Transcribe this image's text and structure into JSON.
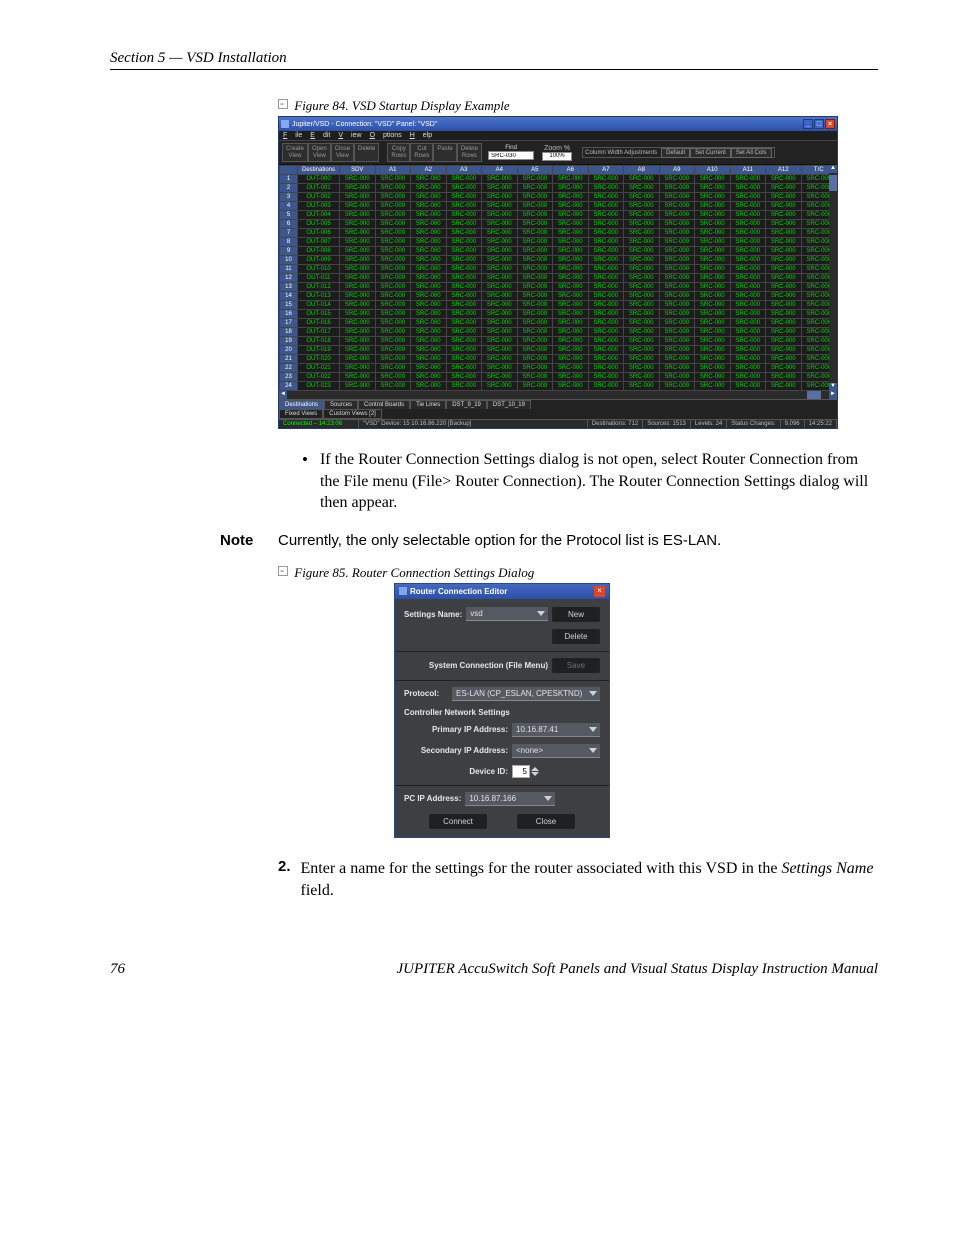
{
  "header": {
    "section_label": "Section 5 — VSD Installation"
  },
  "figure84": {
    "caption": "Figure 84.  VSD Startup Display Example",
    "window_title": "Jupiter/VSD - Connection: \"VSD\"  Panel: \"VSD\"",
    "menus": [
      "File",
      "Edit",
      "View",
      "Options",
      "Help"
    ],
    "toolbar": {
      "left_buttons": [
        [
          "Create",
          "View"
        ],
        [
          "Open",
          "View"
        ],
        [
          "Close",
          "View"
        ],
        [
          "Delete",
          ""
        ]
      ],
      "mid_buttons": [
        [
          "Copy",
          "Rows"
        ],
        [
          "Cut",
          "Rows"
        ],
        [
          "Paste",
          ""
        ],
        [
          "Delete",
          "Rows"
        ]
      ],
      "find_label": "Find",
      "find_value": "SRC-030",
      "zoom_label": "Zoom %",
      "zoom_value": "100%",
      "cwa_label": "Column Width Adjustments",
      "cwa_buttons": [
        "Default",
        "Set Current",
        "Set All Cols"
      ]
    },
    "columns": [
      "",
      "Destinations",
      "SDV",
      "A1",
      "A2",
      "A3",
      "A4",
      "A5",
      "A6",
      "A7",
      "A8",
      "A9",
      "A10",
      "A11",
      "A12",
      "T/C"
    ],
    "rows": [
      {
        "n": "1",
        "dest": "OUT-000"
      },
      {
        "n": "2",
        "dest": "OUT-001"
      },
      {
        "n": "3",
        "dest": "OUT-002"
      },
      {
        "n": "4",
        "dest": "OUT-003"
      },
      {
        "n": "5",
        "dest": "OUT-004"
      },
      {
        "n": "6",
        "dest": "OUT-005"
      },
      {
        "n": "7",
        "dest": "OUT-006"
      },
      {
        "n": "8",
        "dest": "OUT-007"
      },
      {
        "n": "9",
        "dest": "OUT-008"
      },
      {
        "n": "10",
        "dest": "OUT-009"
      },
      {
        "n": "11",
        "dest": "OUT-010"
      },
      {
        "n": "12",
        "dest": "OUT-011"
      },
      {
        "n": "13",
        "dest": "OUT-012"
      },
      {
        "n": "14",
        "dest": "OUT-013"
      },
      {
        "n": "15",
        "dest": "OUT-014"
      },
      {
        "n": "16",
        "dest": "OUT-015"
      },
      {
        "n": "17",
        "dest": "OUT-016"
      },
      {
        "n": "18",
        "dest": "OUT-017"
      },
      {
        "n": "19",
        "dest": "OUT-018"
      },
      {
        "n": "20",
        "dest": "OUT-019"
      },
      {
        "n": "21",
        "dest": "OUT-020"
      },
      {
        "n": "22",
        "dest": "OUT-021"
      },
      {
        "n": "23",
        "dest": "OUT-022"
      },
      {
        "n": "24",
        "dest": "OUT-023"
      }
    ],
    "cell_value": "SRC-000",
    "tabs_row1": [
      "Destinations",
      "Sources",
      "Control Boards",
      "Tie Lines",
      "DST_9_19",
      "DST_10_19"
    ],
    "tabs_row1_active": "Destinations",
    "tabs_row2": [
      "Fixed Views",
      "Custom Views [2]"
    ],
    "status": {
      "connected": "Connected – 14:23:06",
      "device": "\"VSD\" Device: 15   10.16.86.220 [Backup]",
      "destinations": "Destinations:  712",
      "sources": "Sources:  1513",
      "levels": "Levels:  24",
      "status_changes_lbl": "Status Changes:",
      "status_changes_val": "9,096",
      "clock": "14:25:22"
    }
  },
  "body": {
    "bullet1": "If the Router Connection Settings dialog is not open, select Router Connection from the File menu (File> Router Connection). The Router Connection Settings dialog will then appear.",
    "note_label": "Note",
    "note_text": "Currently, the only selectable option for the Protocol list is ES-LAN."
  },
  "figure85": {
    "caption": "Figure 85.  Router Connection Settings Dialog",
    "title": "Router Connection Editor",
    "settings_name_label": "Settings Name:",
    "settings_name_value": "vsd",
    "new_btn": "New",
    "delete_btn": "Delete",
    "system_conn_label": "System Connection (File Menu)",
    "save_btn": "Save",
    "protocol_label": "Protocol:",
    "protocol_value": "ES-LAN (CP_ESLAN, CPESKTND)",
    "cns_label": "Controller Network Settings",
    "primary_ip_label": "Primary IP Address:",
    "primary_ip_value": "10.16.87.41",
    "secondary_ip_label": "Secondary IP Address:",
    "secondary_ip_value": "<none>",
    "device_id_label": "Device ID:",
    "device_id_value": "5",
    "pc_ip_label": "PC IP Address:",
    "pc_ip_value": "10.16.87.166",
    "connect_btn": "Connect",
    "close_btn": "Close"
  },
  "step2": {
    "num": "2.",
    "text_a": "Enter a name for the settings for the router associated with this VSD in the ",
    "text_b_italic": "Settings Name",
    "text_c": " field."
  },
  "footer": {
    "page": "76",
    "manual": "JUPITER AccuSwitch Soft Panels and Visual Status Display Instruction Manual"
  }
}
